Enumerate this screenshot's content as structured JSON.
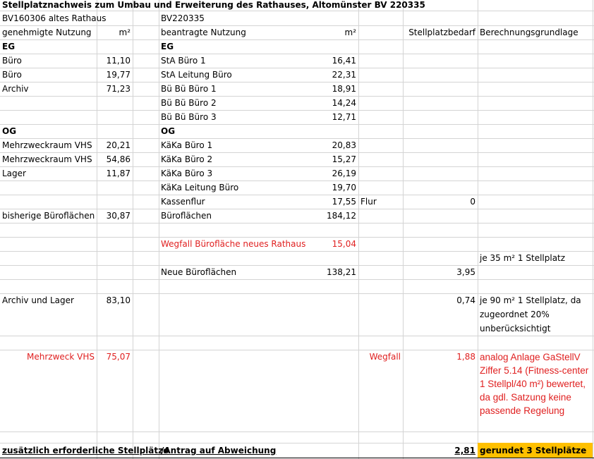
{
  "sheet": {
    "title": "Stellplatznachweis zum Umbau und Erweiterung des Rathauses, Altomünster BV 220335",
    "bv_old": "BV160306 altes Rathaus",
    "bv_new": "BV220335",
    "hdr_genehmigt": "genehmigte Nutzung",
    "hdr_m2_a": "m²",
    "hdr_beantragt": "beantragte Nutzung",
    "hdr_m2_b": "m²",
    "hdr_bedarf": "Stellplatzbedarf",
    "hdr_grundlage": "Berechnungsgrundlage",
    "eg_left": "EG",
    "eg_right": "EG",
    "og_left": "OG",
    "og_right": "OG"
  },
  "rows": {
    "r1": {
      "a": "Büro",
      "b": "11,10",
      "c": "StA Büro 1",
      "d": "16,41"
    },
    "r2": {
      "a": "Büro",
      "b": "19,77",
      "c": "StA Leitung Büro",
      "d": "22,31"
    },
    "r3": {
      "a": "Archiv",
      "b": "71,23",
      "c": "Bü Bü Büro 1",
      "d": "18,91"
    },
    "r4": {
      "c": "Bü Bü Büro 2",
      "d": "14,24"
    },
    "r5": {
      "c": "Bü Bü Büro 3",
      "d": "12,71"
    },
    "r6": {
      "a": "Mehrzweckraum VHS",
      "b": "20,21",
      "c": "KäKa Büro 1",
      "d": "20,83"
    },
    "r7": {
      "a": "Mehrzweckraum VHS",
      "b": "54,86",
      "c": "KäKa Büro 2",
      "d": "15,27"
    },
    "r8": {
      "a": "Lager",
      "b": "11,87",
      "c": "KäKa Büro 3",
      "d": "26,19"
    },
    "r9": {
      "c": "KäKa Leitung Büro",
      "d": "19,70"
    },
    "r10": {
      "c": "Kassenflur",
      "d": "17,55",
      "e": "Flur",
      "f": "0"
    },
    "r11": {
      "a": "bisherige Büroflächen",
      "b": "30,87",
      "c": "Büroflächen",
      "d": "184,12"
    },
    "r12": {
      "c": "Wegfall Bürofläche neues Rathaus",
      "d": "15,04"
    },
    "r13": {
      "g": "je 35 m² 1 Stellplatz"
    },
    "r14": {
      "c": "Neue Büroflächen",
      "d": "138,21",
      "f": "3,95"
    },
    "r15": {
      "a": "Archiv und Lager",
      "b": "83,10",
      "f": "0,74",
      "g": "je 90 m² 1 Stellplatz, da zugeordnet 20% unberücksichtigt"
    },
    "r16": {
      "a": "Mehrzweck VHS",
      "b": "75,07",
      "e": "Wegfall",
      "f": "1,88",
      "g": "analog Anlage GaStellV Ziffer 5.14 (Fitness-center 1 Stellpl/40 m²) bewertet, da gdl. Satzung keine passende Regelung"
    },
    "total": {
      "a": "zusätzlich erforderliche Stellplätze",
      "c": "/Antrag auf Abweichung",
      "f": "2,81",
      "g": "gerundet 3 Stellplätze"
    }
  },
  "colors": {
    "highlight": "#ffc000",
    "red_text": "#e02020",
    "gridline": "#d4d4d4"
  }
}
